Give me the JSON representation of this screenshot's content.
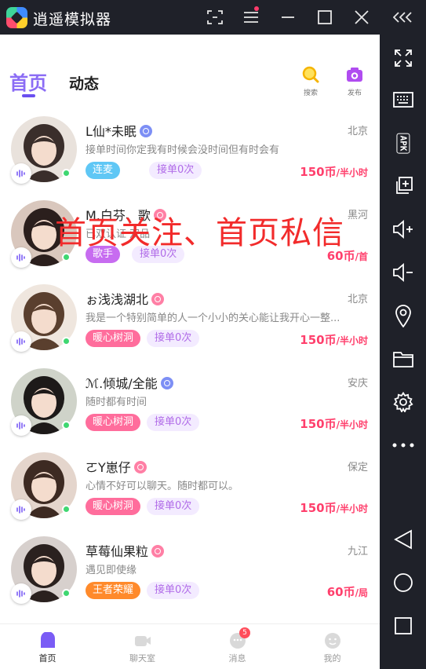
{
  "window": {
    "title": "逍遥模拟器",
    "controls": [
      "screenshot-icon",
      "menu-icon",
      "minimize-icon",
      "maximize-icon",
      "close-icon",
      "collapse-icon"
    ]
  },
  "sidebar": {
    "items": [
      {
        "icon": "fullscreen-icon"
      },
      {
        "icon": "keyboard-icon"
      },
      {
        "icon": "apk-icon",
        "label": "APK"
      },
      {
        "icon": "multi-window-icon"
      },
      {
        "icon": "volume-up-icon"
      },
      {
        "icon": "volume-down-icon"
      },
      {
        "icon": "location-icon"
      },
      {
        "icon": "folder-icon"
      },
      {
        "icon": "settings-icon"
      },
      {
        "icon": "more-icon"
      },
      {
        "icon": "back-icon"
      },
      {
        "icon": "home-icon"
      },
      {
        "icon": "recents-icon"
      }
    ]
  },
  "app": {
    "tabs": {
      "home": "首页",
      "dynamic": "动态"
    },
    "actions": {
      "search": "搜索",
      "publish": "发布"
    },
    "overlay_text": "首页关注、首页私信",
    "users": [
      {
        "name": "L仙*未眠",
        "gender": "male",
        "city": "北京",
        "desc": "接单时间你定我有时候会没时间但有时会有",
        "tag": "连麦",
        "tag_color": "#5fc7f5",
        "orders": "接单0次",
        "price": "150币",
        "unit": "/半小时"
      },
      {
        "name": "M.白芬、歌",
        "gender": "female",
        "city": "黑河",
        "desc": "已双认证·双品",
        "tag": "歌手",
        "tag_color": "#c76cf0",
        "orders": "接单0次",
        "price": "60币",
        "unit": "/首"
      },
      {
        "name": "ぉ浅浅湖北",
        "gender": "female",
        "city": "北京",
        "desc": "我是一个特别简单的人一个小小的关心能让我开心一整...",
        "tag": "暖心树洞",
        "tag_color": "#ff6d9c",
        "orders": "接单0次",
        "price": "150币",
        "unit": "/半小时"
      },
      {
        "name": "ℳ.倾城/全能",
        "gender": "male",
        "city": "安庆",
        "desc": "随时都有时间",
        "tag": "暖心树洞",
        "tag_color": "#ff6d9c",
        "orders": "接单0次",
        "price": "150币",
        "unit": "/半小时"
      },
      {
        "name": "ㄛY崽仔",
        "gender": "female",
        "city": "保定",
        "desc": "心情不好可以聊天。随时都可以。",
        "tag": "暖心树洞",
        "tag_color": "#ff6d9c",
        "orders": "接单0次",
        "price": "150币",
        "unit": "/半小时"
      },
      {
        "name": "草莓仙果粒",
        "gender": "female",
        "city": "九江",
        "desc": "遇见即使缘",
        "tag": "王者荣耀",
        "tag_color": "#ff8a2b",
        "orders": "接单0次",
        "price": "60币",
        "unit": "/局"
      }
    ],
    "bottom_nav": [
      {
        "label": "首页",
        "active": true
      },
      {
        "label": "聊天室",
        "active": false
      },
      {
        "label": "消息",
        "active": false,
        "badge": "5"
      },
      {
        "label": "我的",
        "active": false
      }
    ]
  }
}
